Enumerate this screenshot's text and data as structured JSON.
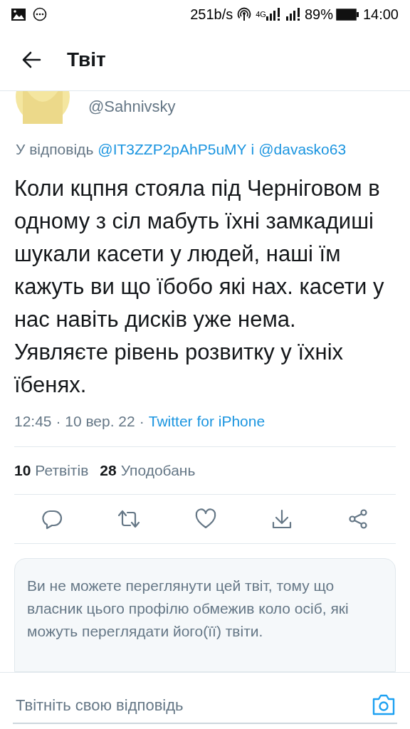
{
  "status_bar": {
    "net_speed": "251b/s",
    "network": "4G",
    "battery": "89%",
    "time": "14:00"
  },
  "header": {
    "title": "Твіт"
  },
  "tweet": {
    "handle": "@Sahnivsky",
    "reply_prefix": "У відповідь",
    "reply_to": [
      "@IT3ZZP2pAhP5uMY",
      "@davasko63"
    ],
    "reply_joiner": "і",
    "text": "Коли кцпня стояла під Черніговом в одному з сіл мабуть їхні замкадиші шукали касети у людей, наші їм кажуть ви що їбобо які нах. касети у нас навіть дисків уже нема. Уявляєте рівень розвитку у їхніх їбенях.",
    "time": "12:45 · 10 вер. 22",
    "separator": "·",
    "source": "Twitter for iPhone",
    "retweets": {
      "count": "10",
      "label": "Ретвітів"
    },
    "likes": {
      "count": "28",
      "label": "Уподобань"
    }
  },
  "notice": {
    "text": "Ви не можете переглянути цей твіт, тому що власник цього профілю обмежив коло осіб, які можуть переглядати його(її) твіти."
  },
  "reply_bar": {
    "placeholder": "Твітніть свою відповідь"
  }
}
